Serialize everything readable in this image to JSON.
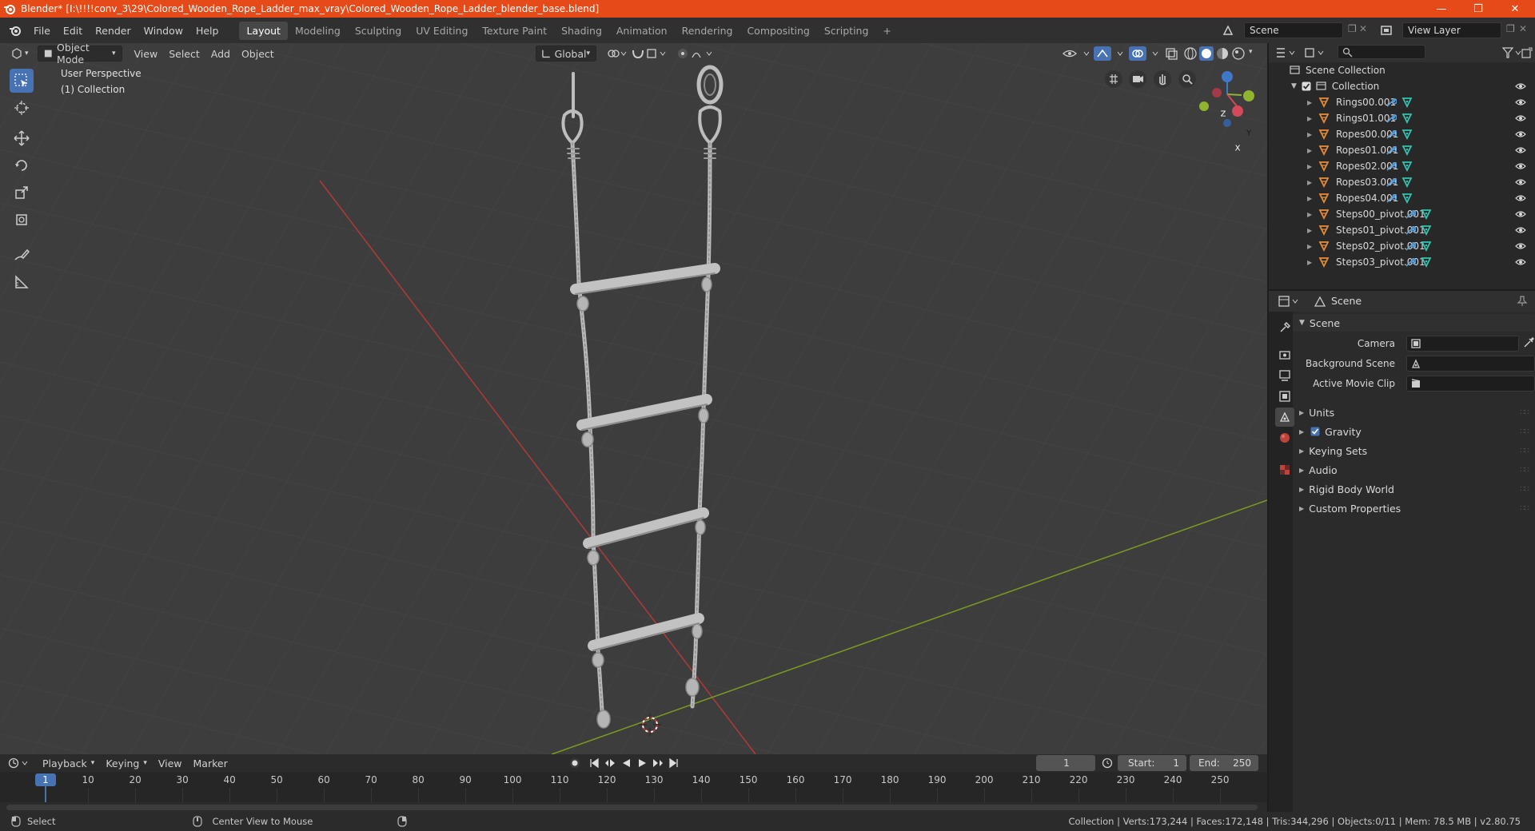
{
  "window": {
    "title": "Blender* [I:\\!!!!conv_3\\29\\Colored_Wooden_Rope_Ladder_max_vray\\Colored_Wooden_Rope_Ladder_blender_base.blend]",
    "minimize": "—",
    "maximize": "❐",
    "close": "✕"
  },
  "menu": [
    "File",
    "Edit",
    "Render",
    "Window",
    "Help"
  ],
  "workspaces": [
    {
      "label": "Layout",
      "active": true
    },
    {
      "label": "Modeling"
    },
    {
      "label": "Sculpting"
    },
    {
      "label": "UV Editing"
    },
    {
      "label": "Texture Paint"
    },
    {
      "label": "Shading"
    },
    {
      "label": "Animation"
    },
    {
      "label": "Rendering"
    },
    {
      "label": "Compositing"
    },
    {
      "label": "Scripting"
    }
  ],
  "add_workspace": "+",
  "scene_field": "Scene",
  "view_layer_field": "View Layer",
  "viewport": {
    "mode": "Object Mode",
    "menus": [
      "View",
      "Select",
      "Add",
      "Object"
    ],
    "orientation": "Global",
    "overlay_title": "User Perspective",
    "overlay_collection": "(1) Collection",
    "gizmo": {
      "z": "Z",
      "y": "Y",
      "x": "X"
    }
  },
  "outliner": {
    "root": "Scene Collection",
    "collection": "Collection",
    "items": [
      {
        "name": "Rings00.001"
      },
      {
        "name": "Rings01.001"
      },
      {
        "name": "Ropes00.001"
      },
      {
        "name": "Ropes01.001"
      },
      {
        "name": "Ropes02.001"
      },
      {
        "name": "Ropes03.001"
      },
      {
        "name": "Ropes04.001"
      },
      {
        "name": "Steps00_pivot.001"
      },
      {
        "name": "Steps01_pivot.001"
      },
      {
        "name": "Steps02_pivot.001"
      },
      {
        "name": "Steps03_pivot.001"
      }
    ]
  },
  "properties": {
    "context": "Scene",
    "panel": "Scene",
    "fields": [
      {
        "label": "Camera"
      },
      {
        "label": "Background Scene"
      },
      {
        "label": "Active Movie Clip"
      }
    ],
    "sections": [
      {
        "label": "Units",
        "checkbox": false
      },
      {
        "label": "Gravity",
        "checkbox": true
      },
      {
        "label": "Keying Sets",
        "checkbox": false
      },
      {
        "label": "Audio",
        "checkbox": false
      },
      {
        "label": "Rigid Body World",
        "checkbox": false
      },
      {
        "label": "Custom Properties",
        "checkbox": false
      }
    ]
  },
  "timeline": {
    "menus": [
      "Playback",
      "Keying",
      "View",
      "Marker"
    ],
    "current_frame": "1",
    "start_label": "Start:",
    "start": "1",
    "end_label": "End:",
    "end": "250",
    "ticks": [
      "1",
      "10",
      "20",
      "30",
      "40",
      "50",
      "60",
      "70",
      "80",
      "90",
      "100",
      "110",
      "120",
      "130",
      "140",
      "150",
      "160",
      "170",
      "180",
      "190",
      "200",
      "210",
      "220",
      "230",
      "240",
      "250"
    ]
  },
  "status": {
    "left_action": "Select",
    "mid_action": "Center View to Mouse",
    "stats": "Collection | Verts:173,244 | Faces:172,148 | Tris:344,296 | Objects:0/11 | Mem: 78.5 MB | v2.80.75"
  },
  "colors": {
    "titlebar": "#e64a19",
    "accent": "#4772b3",
    "x_axis": "#c0392b",
    "y_axis": "#7c9a1e",
    "mesh_icon": "#e78a3a",
    "data_icon": "#33c3b0"
  }
}
